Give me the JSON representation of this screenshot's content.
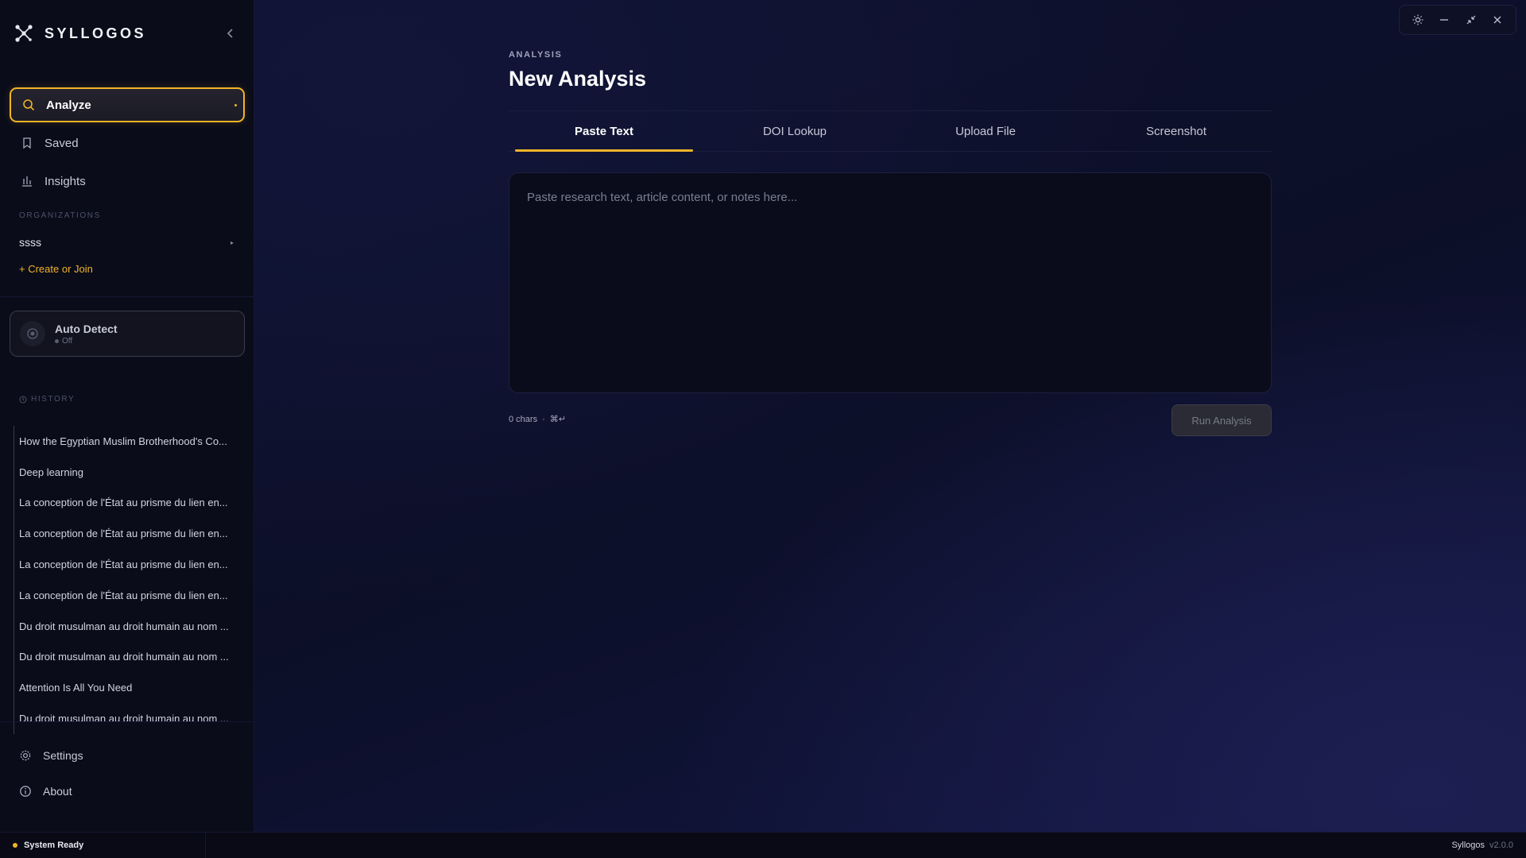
{
  "app": {
    "name": "SYLLOGOS"
  },
  "sidebar": {
    "nav": [
      {
        "label": "Analyze",
        "icon": "search-icon",
        "active": true
      },
      {
        "label": "Saved",
        "icon": "bookmark-icon"
      },
      {
        "label": "Insights",
        "icon": "bar-chart-icon"
      }
    ],
    "organizations_label": "ORGANIZATIONS",
    "org_name": "ssss",
    "create_join": "+ Create or Join",
    "auto_detect": {
      "title": "Auto Detect",
      "status": "Off"
    },
    "history_label": "HISTORY",
    "history": [
      "How the Egyptian Muslim Brotherhood's Co...",
      "Deep learning",
      "La conception de l'État au prisme du lien en...",
      "La conception de l'État au prisme du lien en...",
      "La conception de l'État au prisme du lien en...",
      "La conception de l'État au prisme du lien en...",
      "Du droit musulman au droit humain au nom ...",
      "Du droit musulman au droit humain au nom ...",
      "Attention Is All You Need",
      "Du droit musulman au droit humain au nom ..."
    ],
    "footer": [
      {
        "label": "Settings",
        "icon": "gear-icon"
      },
      {
        "label": "About",
        "icon": "info-icon"
      }
    ]
  },
  "main": {
    "crumb": "ANALYSIS",
    "title": "New Analysis",
    "tabs": [
      {
        "label": "Paste Text",
        "active": true
      },
      {
        "label": "DOI Lookup"
      },
      {
        "label": "Upload File"
      },
      {
        "label": "Screenshot"
      }
    ],
    "input": {
      "placeholder": "Paste research text, article content, or notes here...",
      "value": ""
    },
    "char_count": "0 chars",
    "separator": "·",
    "shortcut": "⌘↵",
    "run_button": "Run Analysis"
  },
  "statusbar": {
    "status": "System Ready",
    "app_name": "Syllogos",
    "version": "v2.0.0"
  },
  "colors": {
    "accent": "#f0b429",
    "background": "#0c0f27",
    "sidebar": "#0a0c1a"
  }
}
